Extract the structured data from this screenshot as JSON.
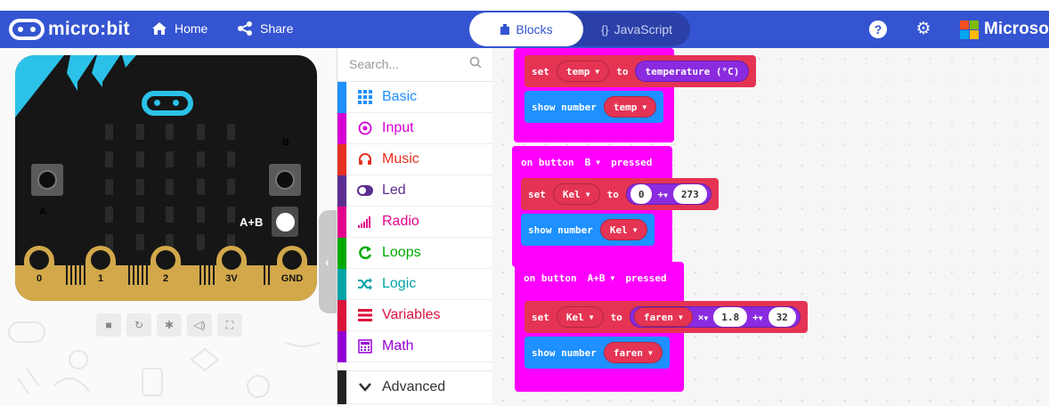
{
  "header": {
    "logo_text": "micro:bit",
    "nav_home": "Home",
    "nav_share": "Share",
    "tab_blocks": "Blocks",
    "tab_js": "JavaScript",
    "help_glyph": "?",
    "settings_glyph": "⚙",
    "brand": "Microsof",
    "colors": {
      "header": "#3454d1",
      "accent_dark": "#2a40a8"
    }
  },
  "simulator": {
    "btn_a_label": "A",
    "btn_b_label": "B",
    "btn_ab_label": "A+B",
    "pins": [
      "0",
      "1",
      "2",
      "3V",
      "GND"
    ],
    "controls": [
      "stop-icon",
      "restart-icon",
      "debug-icon",
      "sound-icon",
      "fullscreen-icon"
    ]
  },
  "toolbox": {
    "search_placeholder": "Search...",
    "categories": [
      {
        "label": "Basic",
        "color": "#1e90ff",
        "icon": "grid-icon"
      },
      {
        "label": "Input",
        "color": "#d400d4",
        "icon": "target-icon"
      },
      {
        "label": "Music",
        "color": "#e63022",
        "icon": "headphones-icon"
      },
      {
        "label": "Led",
        "color": "#5c2d91",
        "icon": "toggle-icon"
      },
      {
        "label": "Radio",
        "color": "#e3008c",
        "icon": "signal-icon"
      },
      {
        "label": "Loops",
        "color": "#00aa00",
        "icon": "refresh-icon"
      },
      {
        "label": "Logic",
        "color": "#00a4a6",
        "icon": "shuffle-icon"
      },
      {
        "label": "Variables",
        "color": "#dc143c",
        "icon": "list-icon"
      },
      {
        "label": "Math",
        "color": "#9400d3",
        "icon": "calculator-icon"
      }
    ],
    "advanced_label": "Advanced"
  },
  "workspace": {
    "block1": {
      "set": "set",
      "var": "temp",
      "to": "to",
      "value": "temperature (°C)",
      "show": "show number",
      "show_var": "temp"
    },
    "block2": {
      "header_prefix": "on button",
      "button": "B",
      "header_suffix": "pressed",
      "set": "set",
      "var": "Kel",
      "to": "to",
      "a": "0",
      "op": "+",
      "b": "273",
      "show": "show number",
      "show_var": "Kel"
    },
    "block3": {
      "header_prefix": "on button",
      "button": "A+B",
      "header_suffix": "pressed",
      "set": "set",
      "var": "Kel",
      "to": "to",
      "inner_var": "faren",
      "mul": "×",
      "factor": "1.8",
      "add": "+",
      "offset": "32",
      "show": "show number",
      "show_var": "faren"
    },
    "colors": {
      "event": "#ff00ff",
      "variables": "#e53453",
      "basic": "#1e90ff",
      "math": "#8b2be0"
    }
  }
}
